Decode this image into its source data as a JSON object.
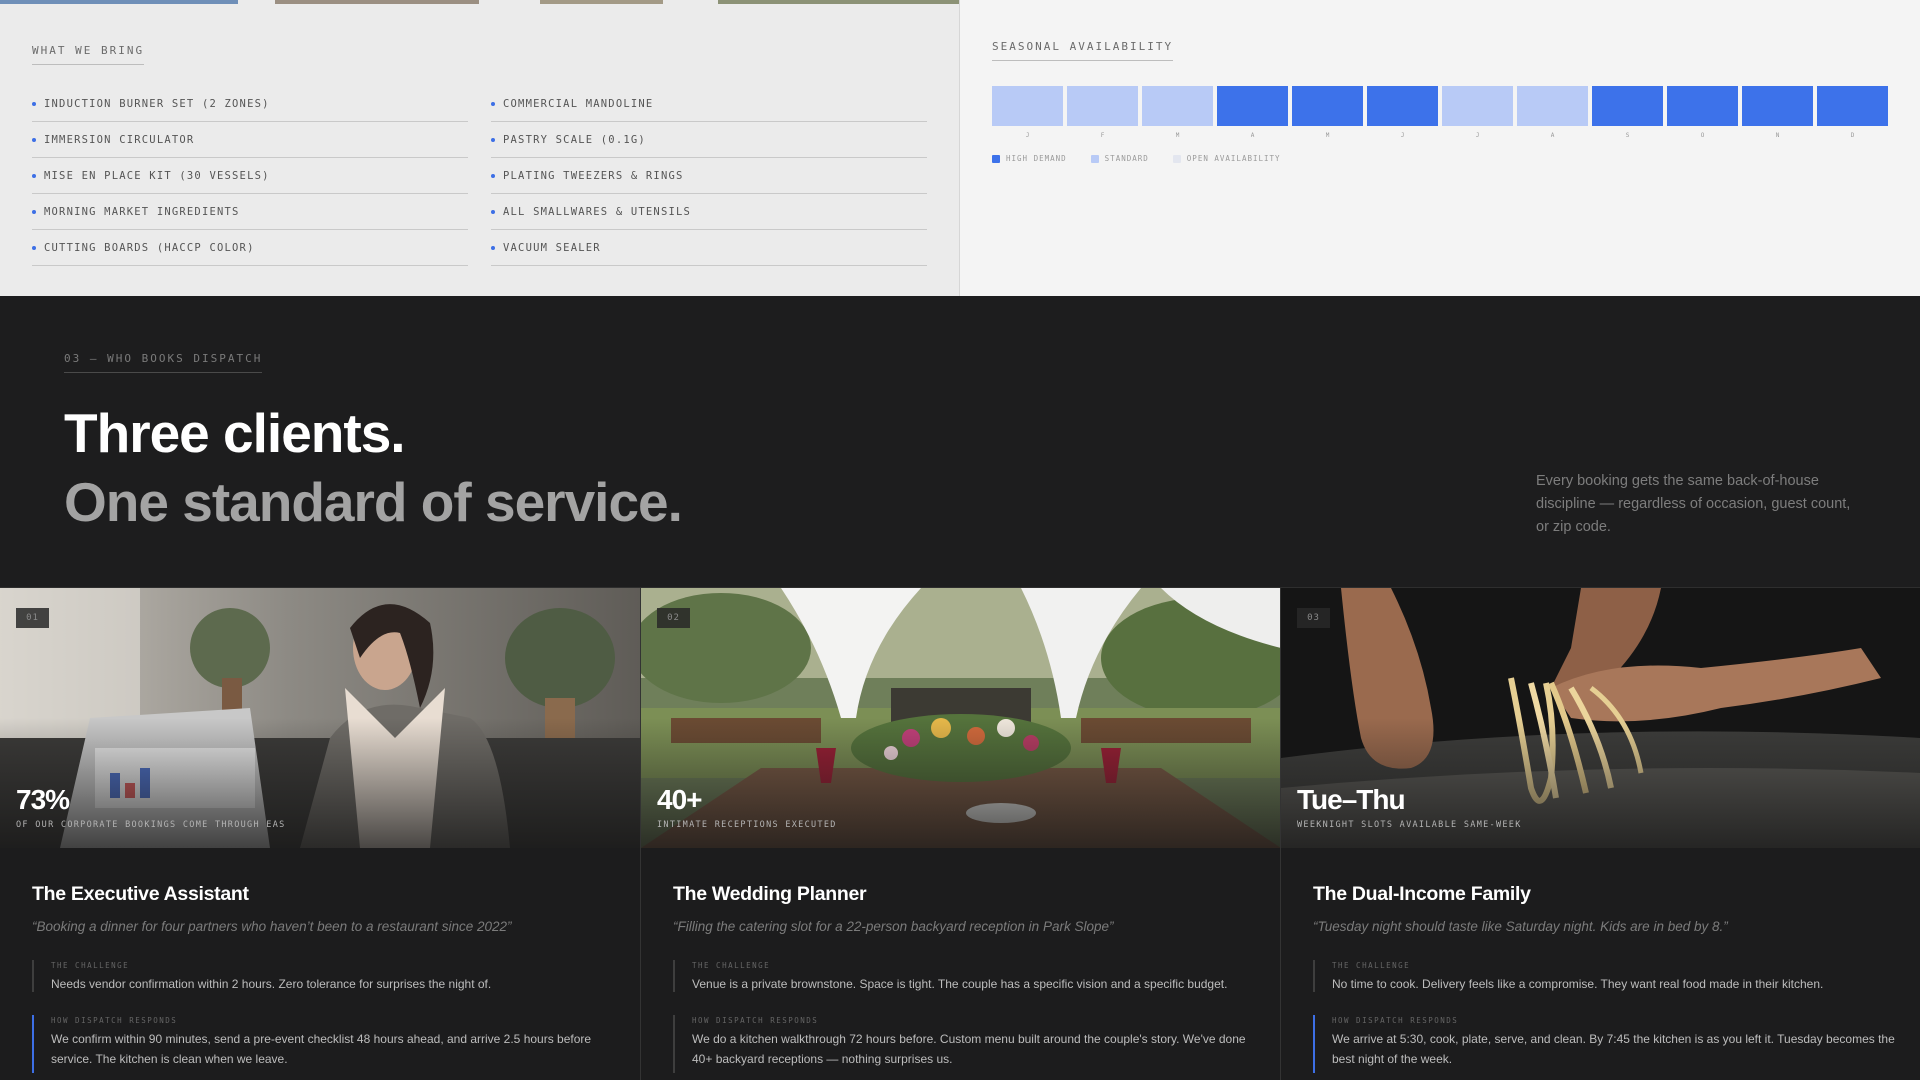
{
  "bring": {
    "eyebrow": "WHAT WE BRING",
    "left_items": [
      "INDUCTION BURNER SET (2 ZONES)",
      "IMMERSION CIRCULATOR",
      "MISE EN PLACE KIT (30 VESSELS)",
      "MORNING MARKET INGREDIENTS",
      "CUTTING BOARDS (HACCP COLOR)"
    ],
    "right_items": [
      "COMMERCIAL MANDOLINE",
      "PASTRY SCALE (0.1G)",
      "PLATING TWEEZERS & RINGS",
      "ALL SMALLWARES & UTENSILS",
      "VACUUM SEALER"
    ]
  },
  "season": {
    "eyebrow": "SEASONAL AVAILABILITY",
    "months": [
      {
        "label": "J",
        "level": "standard"
      },
      {
        "label": "F",
        "level": "standard"
      },
      {
        "label": "M",
        "level": "standard"
      },
      {
        "label": "A",
        "level": "high"
      },
      {
        "label": "M",
        "level": "high"
      },
      {
        "label": "J",
        "level": "high"
      },
      {
        "label": "J",
        "level": "standard"
      },
      {
        "label": "A",
        "level": "standard"
      },
      {
        "label": "S",
        "level": "high"
      },
      {
        "label": "O",
        "level": "high"
      },
      {
        "label": "N",
        "level": "high"
      },
      {
        "label": "D",
        "level": "high"
      }
    ],
    "legend": [
      {
        "key": "high",
        "label": "HIGH DEMAND",
        "color": "#3d72ea"
      },
      {
        "key": "standard",
        "label": "STANDARD",
        "color": "#b8caf6"
      },
      {
        "key": "open",
        "label": "OPEN AVAILABILITY",
        "color": "#e3e6ef"
      }
    ]
  },
  "who": {
    "eyebrow": "03 — WHO BOOKS DISPATCH",
    "headline": "Three clients.",
    "subheadline": "One standard of service.",
    "description": "Every booking gets the same back-of-house discipline — regardless of occasion, guest count, or zip code."
  },
  "cards": [
    {
      "badge": "01",
      "stat": "73%",
      "stat_caption": "OF OUR CORPORATE BOOKINGS COME THROUGH EAS",
      "title": "The Executive Assistant",
      "quote": "“Booking a dinner for four partners who haven’t been to a restaurant since 2022”",
      "challenge_label": "THE CHALLENGE",
      "challenge": "Needs vendor confirmation within 2 hours. Zero tolerance for surprises the night of.",
      "respond_label": "HOW DISPATCH RESPONDS",
      "respond": "We confirm within 90 minutes, send a pre-event checklist 48 hours ahead, and arrive 2.5 hours before service. The kitchen is clean when we leave."
    },
    {
      "badge": "02",
      "stat": "40+",
      "stat_caption": "INTIMATE RECEPTIONS EXECUTED",
      "title": "The Wedding Planner",
      "quote": "“Filling the catering slot for a 22-person backyard reception in Park Slope”",
      "challenge_label": "THE CHALLENGE",
      "challenge": "Venue is a private brownstone. Space is tight. The couple has a specific vision and a specific budget.",
      "respond_label": "HOW DISPATCH RESPONDS",
      "respond": "We do a kitchen walkthrough 72 hours before. Custom menu built around the couple's story. We've done 40+ backyard receptions — nothing surprises us."
    },
    {
      "badge": "03",
      "stat": "Tue–Thu",
      "stat_caption": "WEEKNIGHT SLOTS AVAILABLE SAME-WEEK",
      "title": "The Dual-Income Family",
      "quote": "“Tuesday night should taste like Saturday night. Kids are in bed by 8.”",
      "challenge_label": "THE CHALLENGE",
      "challenge": "No time to cook. Delivery feels like a compromise. They want real food made in their kitchen.",
      "respond_label": "HOW DISPATCH RESPONDS",
      "respond": "We arrive at 5:30, cook, plate, serve, and clean. By 7:45 the kitchen is as you left it. Tuesday becomes the best night of the week."
    }
  ],
  "colors": {
    "accent": "#3d6fe6",
    "dark_bg": "#1c1c1d",
    "light_bg": "#ebebeb"
  }
}
